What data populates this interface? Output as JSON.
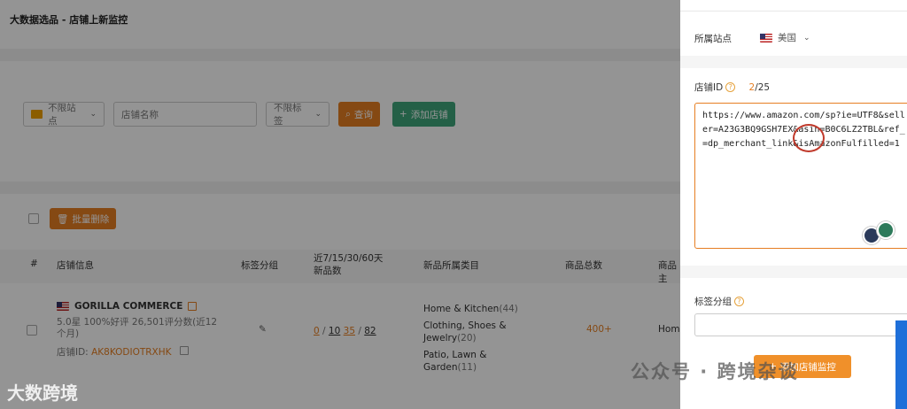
{
  "page": {
    "title": "大数据选品 - 店铺上新监控"
  },
  "filters": {
    "site_select": "不限站点",
    "store_name_placeholder": "店铺名称",
    "tag_select": "不限标签",
    "query_button": "查询",
    "add_store_button": "添加店铺"
  },
  "batch": {
    "delete_button": "批量删除"
  },
  "table": {
    "headers": [
      "#",
      "店铺信息",
      "标签分组",
      "近7/15/30/60天\n新品数",
      "新品所属类目",
      "商品总数",
      "商品主"
    ],
    "rows": [
      {
        "store_name": "GORILLA COMMERCE",
        "rating": "5.0星 100%好评 26,501评分数(近12个月)",
        "store_id_label": "店铺ID:",
        "store_id": "AK8KODIOTRXHK",
        "new_counts": {
          "d7": "0",
          "d15": "10",
          "d30": "35",
          "d60": "82"
        },
        "categories": [
          {
            "name": "Home & Kitchen",
            "count": "(44)"
          },
          {
            "name": "Clothing, Shoes & Jewelry",
            "count": "(20)"
          },
          {
            "name": "Patio, Lawn & Garden",
            "count": "(11)"
          }
        ],
        "total": "400+",
        "main_category": "Home"
      }
    ]
  },
  "drawer": {
    "site_label": "所属站点",
    "site_value": "美国",
    "store_id_label": "店铺ID",
    "store_id_count": "2",
    "store_id_max": "/25",
    "url_text": "https://www.amazon.com/sp?ie=UTF8&seller=A23G3BQ9GSH7EX&asin=B0C6LZ2TBL&ref_=dp_merchant_link&isAmazonFulfilled=1",
    "tag_group_label": "标签分组",
    "save_button": "添加店铺监控"
  },
  "watermark": {
    "brand": "大数跨境",
    "wechat": "公众号 · 跨境杂谈"
  },
  "colors": {
    "accent_orange": "#e67e22",
    "accent_green": "#3ea67a",
    "side_tab_blue": "#1e6fd9"
  }
}
